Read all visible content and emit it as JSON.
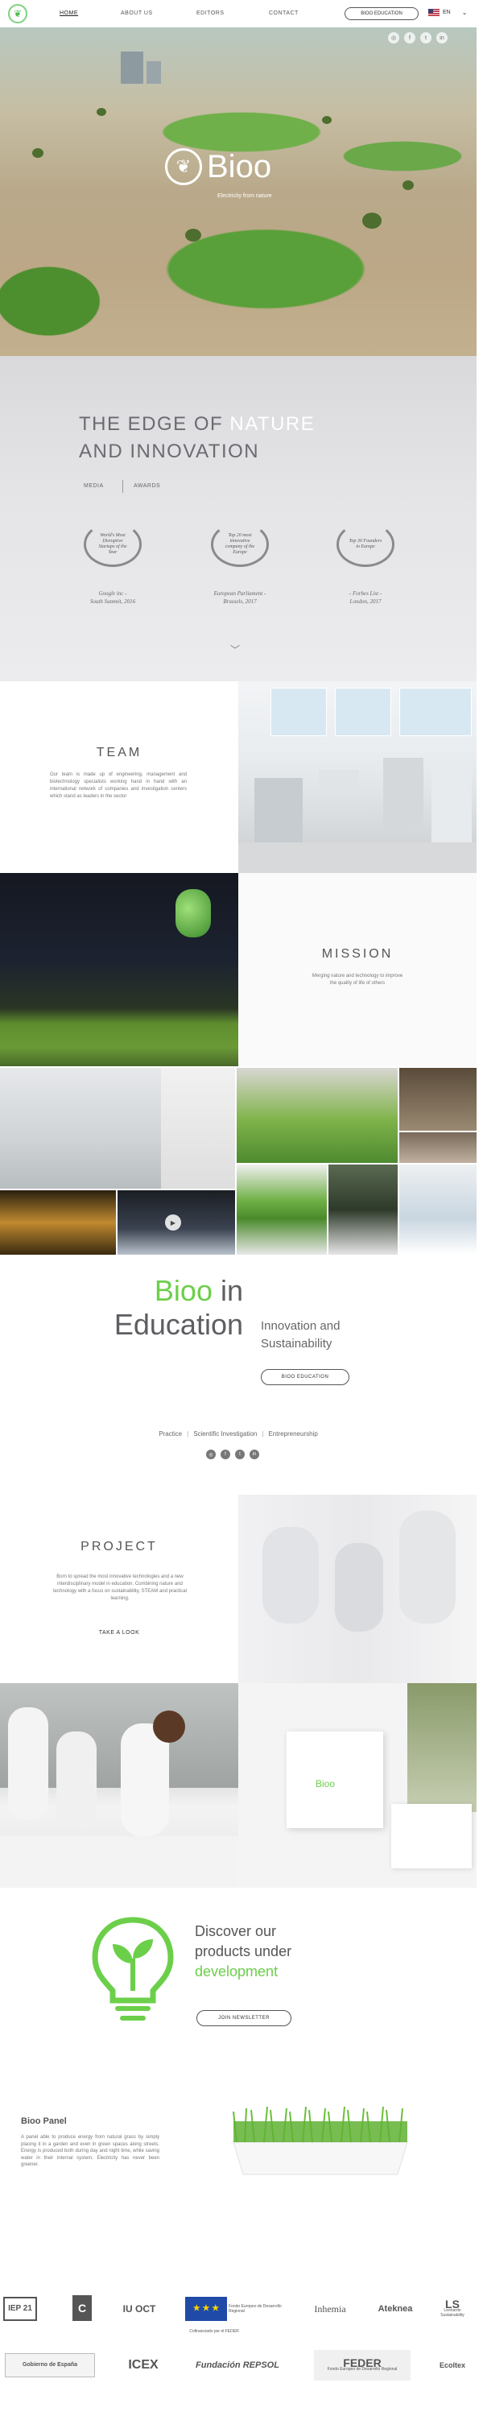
{
  "nav": {
    "logo_icon": "sprout-logo-icon",
    "items": [
      "HOME",
      "ABOUT US",
      "EDITORS",
      "CONTACT"
    ],
    "education_button": "BIOO EDUCATION",
    "language": "EN"
  },
  "hero": {
    "brand": "Bioo",
    "tagline": "Electricity from nature",
    "social_icons": [
      "instagram-icon",
      "facebook-icon",
      "twitter-icon",
      "linkedin-icon"
    ]
  },
  "edge": {
    "title_line1_a": "THE EDGE OF ",
    "title_line1_b": "NATURE",
    "title_line2": "AND INNOVATION",
    "tabs": [
      "MEDIA",
      "AWARDS"
    ],
    "awards": [
      {
        "badge": "World's Most Disruptive Startups of the Year",
        "caption_line1": "Google inc -",
        "caption_line2": "South Summit, 2016"
      },
      {
        "badge": "Top 20 most innovative company of the Europe",
        "caption_line1": "European Parliament -",
        "caption_line2": "Brussels, 2017"
      },
      {
        "badge": "Top 30 Founders in Europe",
        "caption_line1": "- Forbes List -",
        "caption_line2": "London, 2017"
      }
    ]
  },
  "team": {
    "title": "TEAM",
    "text": "Our team is made up of engineering, management and biotechnology specialists working hand in hand with an international network of companies and investigation centers which stand as leaders in the sector"
  },
  "mission": {
    "title": "MISSION",
    "text": "Merging nature and technology to improve the quality of life of others"
  },
  "education": {
    "title_green": "Bioo",
    "title_in": " in",
    "title_line2": "Education",
    "subtitle_line1": "Innovation and",
    "subtitle_line2": "Sustainability",
    "button": "BIOO EDUCATION",
    "links": [
      "Practice",
      "Scientific Investigation",
      "Entrepreneurship"
    ],
    "social_icons": [
      "instagram-icon",
      "facebook-icon",
      "twitter-icon",
      "linkedin-icon"
    ]
  },
  "project": {
    "title": "PROJECT",
    "text": "Born to spread the most innovative technologies and a new interdisciplinary model in education. Combining nature and technology with a focus on sustainability, STEAM and practical learning.",
    "link": "TAKE A LOOK"
  },
  "lab": {
    "box_label": "Bioo"
  },
  "discover": {
    "line1": "Discover our",
    "line2": "products under",
    "line3_green": "development",
    "button": "JOIN NEWSLETTER"
  },
  "panel": {
    "title": "Bioo Panel",
    "text": "A panel able to produce energy from natural grass by simply placing it in a garden and even in green spaces along streets. Energy is produced both during day and night time, while saving water in their internal system. Electricity has never been greener."
  },
  "logos": {
    "row1": [
      "IEP 21",
      "C",
      "IU OCT",
      "Fondo Europeo de Desarrollo Regional",
      "Inhemia",
      "Ateknea",
      "LS"
    ],
    "row2": [
      "Gobierno de España",
      "ICEX",
      "Fundación REPSOL",
      "FEDER",
      "Ecoltex"
    ],
    "eu_caption": "Cofinanciado por el FEDER",
    "feder_sub": "Fondo Europeo de Desarrollo Regional",
    "repsol_sub": "Fundación",
    "ls_sub": "Leonardo Sustainability"
  },
  "colors": {
    "accent_green": "#6ccf4a",
    "text_gray": "#555555"
  }
}
